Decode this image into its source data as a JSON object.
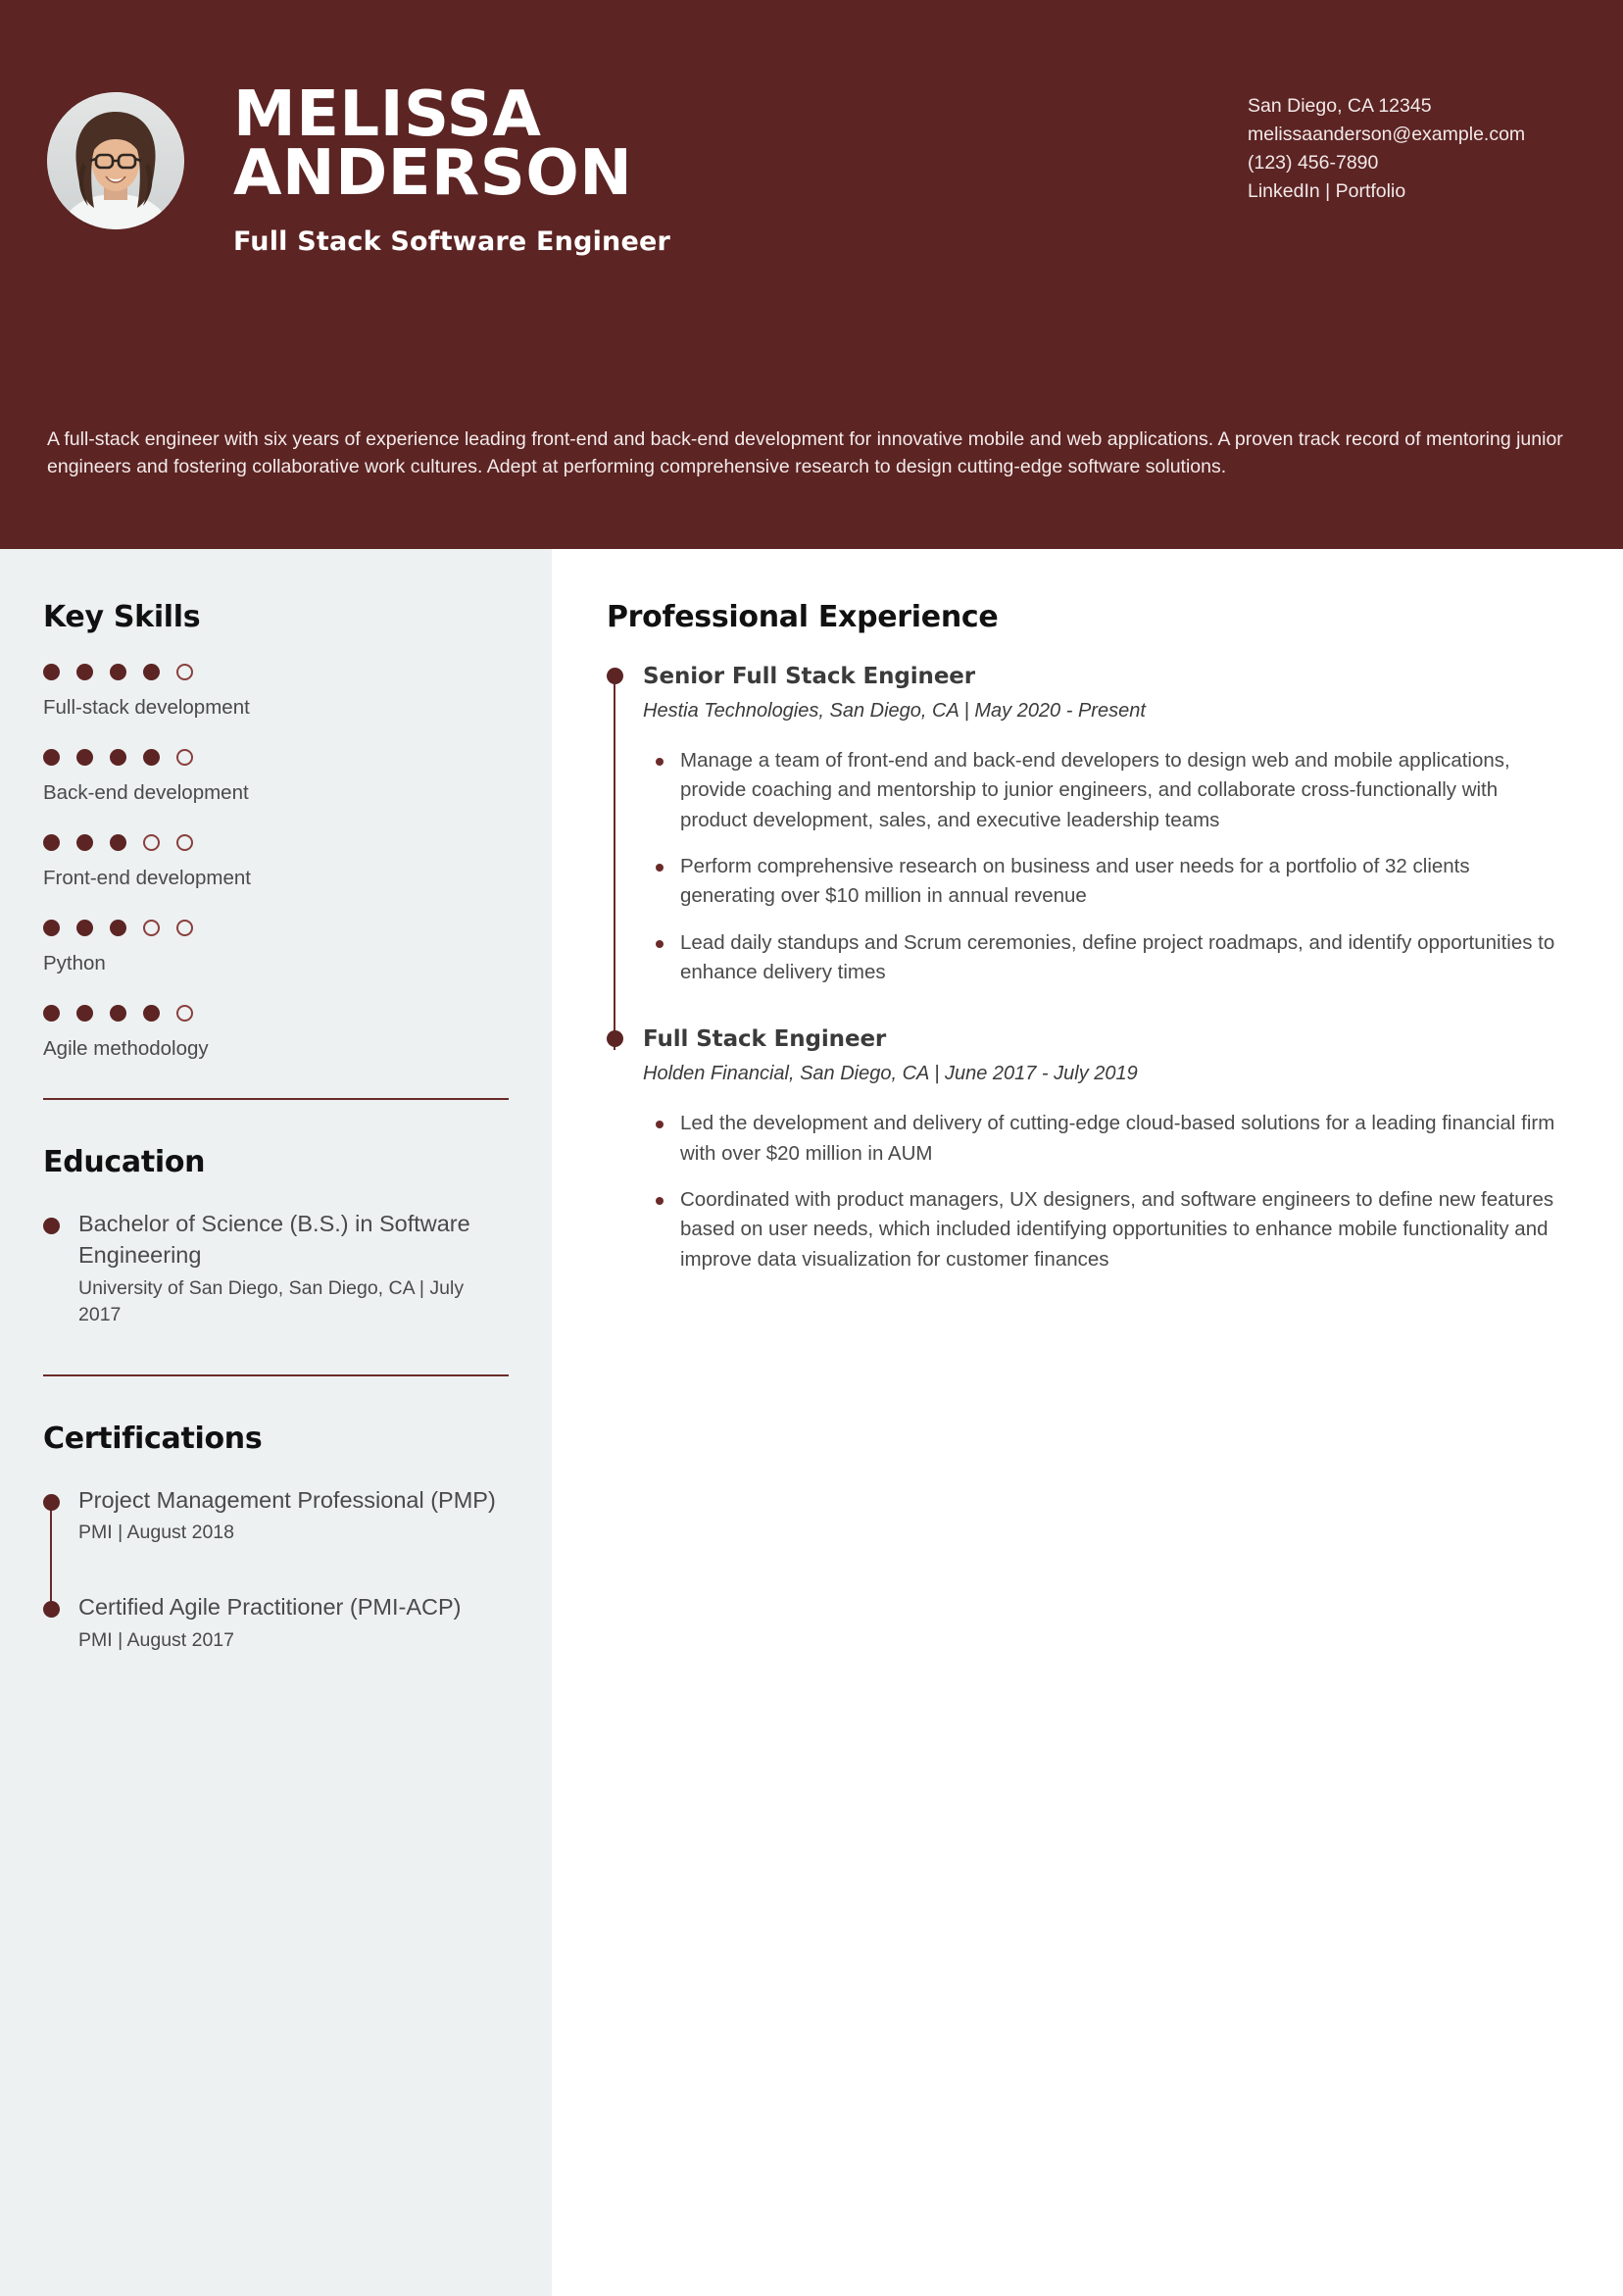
{
  "theme": {
    "header_bg": "#5C2423",
    "sidebar_bg": "#EDF1F2",
    "accent": "#6B2B2A",
    "page_bg": "#FFFFFF",
    "body_text": "#4A4A4A",
    "heading_text": "#111111"
  },
  "header": {
    "name_line1": "MELISSA",
    "name_line2": "ANDERSON",
    "role": "Full Stack Software Engineer",
    "avatar_alt": "portrait-photo",
    "contact": {
      "location": "San Diego, CA 12345",
      "email": "melissaanderson@example.com",
      "phone": "(123) 456-7890",
      "links": "LinkedIn | Portfolio"
    },
    "summary": "A full-stack engineer with six years of experience leading front-end and back-end development for innovative mobile and web applications. A proven track record of mentoring junior engineers and fostering collaborative work cultures. Adept at performing comprehensive research to design cutting-edge software solutions."
  },
  "sidebar": {
    "skills": {
      "title": "Key Skills",
      "max_rating": 5,
      "items": [
        {
          "label": "Full-stack development",
          "rating": 4
        },
        {
          "label": "Back-end development",
          "rating": 4
        },
        {
          "label": "Front-end development",
          "rating": 3
        },
        {
          "label": "Python",
          "rating": 3
        },
        {
          "label": "Agile methodology",
          "rating": 4
        }
      ]
    },
    "education": {
      "title": "Education",
      "items": [
        {
          "degree": "Bachelor of Science (B.S.) in Software Engineering",
          "detail": "University of San Diego, San Diego, CA | July 2017"
        }
      ]
    },
    "certifications": {
      "title": "Certifications",
      "items": [
        {
          "name": "Project Management Professional (PMP)",
          "detail": "PMI | August 2018"
        },
        {
          "name": "Certified Agile Practitioner (PMI-ACP)",
          "detail": "PMI | August 2017"
        }
      ]
    }
  },
  "main": {
    "experience": {
      "title": "Professional Experience",
      "jobs": [
        {
          "title": "Senior Full Stack Engineer",
          "meta": "Hestia Technologies, San Diego, CA | May 2020 - Present",
          "bullets": [
            "Manage a team of front-end and back-end developers to design web and mobile applications, provide coaching and mentorship to junior engineers, and collaborate cross-functionally with product development, sales, and executive leadership teams",
            "Perform comprehensive research on business and user needs for a portfolio of 32 clients generating over $10 million in annual revenue",
            "Lead daily standups and Scrum ceremonies, define project roadmaps, and identify opportunities to enhance delivery times"
          ]
        },
        {
          "title": "Full Stack Engineer",
          "meta": "Holden Financial, San Diego, CA | June 2017 - July 2019",
          "bullets": [
            "Led the development and delivery of cutting-edge cloud-based solutions for a leading financial firm with over $20 million in AUM",
            "Coordinated with product managers, UX designers, and software engineers to define new features based on user needs, which included identifying opportunities to enhance mobile functionality and improve data visualization for customer finances"
          ]
        }
      ]
    }
  }
}
